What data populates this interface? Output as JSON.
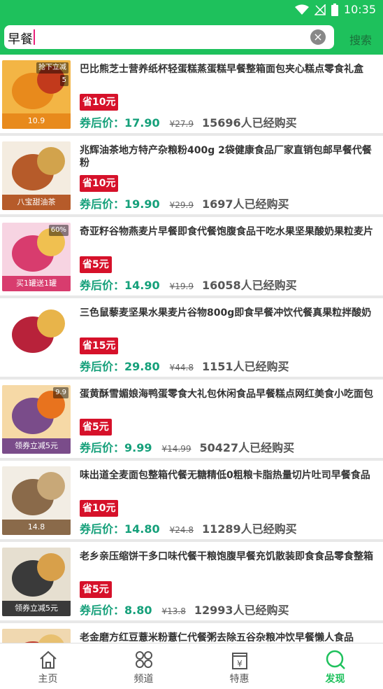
{
  "status_bar": {
    "time": "10:35"
  },
  "search": {
    "query": "早餐",
    "button_label": "搜索"
  },
  "products": [
    {
      "title": "巴比熊芝士营养纸杯轻蛋糕蒸蛋糕早餐整箱面包夹心糕点零食礼盒",
      "coupon": "省10元",
      "after_price": "券后价：17.90",
      "original_price": "¥27.9",
      "sold": "15696人已经购买",
      "thumb_colors": [
        "#f3b545",
        "#e88a1c",
        "#c23a1c"
      ],
      "thumb_texts": [
        "10.9",
        "抢下立减",
        "5"
      ]
    },
    {
      "title": "兆辉油茶地方特产杂粮粉400g 2袋健康食品厂家直销包邮早餐代餐粉",
      "coupon": "省10元",
      "after_price": "券后价：19.90",
      "original_price": "¥29.9",
      "sold": "1697人已经购买",
      "thumb_colors": [
        "#f4ece0",
        "#b65b2a",
        "#d2a34c"
      ],
      "thumb_texts": [
        "八宝甜油茶"
      ]
    },
    {
      "title": "奇亚籽谷物燕麦片早餐即食代餐饱腹食品干吃水果坚果酸奶果粒麦片",
      "coupon": "省5元",
      "after_price": "券后价：14.90",
      "original_price": "¥19.9",
      "sold": "16058人已经购买",
      "thumb_colors": [
        "#f7d4e2",
        "#d83c6e",
        "#f0c050"
      ],
      "thumb_texts": [
        "买1罐送1罐",
        "60%"
      ]
    },
    {
      "title": "三色鼠藜麦坚果水果麦片谷物800g即食早餐冲饮代餐真果粒拌酸奶",
      "coupon": "省15元",
      "after_price": "券后价：29.80",
      "original_price": "¥44.8",
      "sold": "1151人已经购买",
      "thumb_colors": [
        "#ffffff",
        "#b8223a",
        "#e8b44a"
      ],
      "thumb_texts": []
    },
    {
      "title": "蛋黄酥雪媚娘海鸭蛋零食大礼包休闲食品早餐糕点网红美食小吃面包",
      "coupon": "省5元",
      "after_price": "券后价：9.99",
      "original_price": "¥14.99",
      "sold": "50427人已经购买",
      "thumb_colors": [
        "#f6d9a6",
        "#7a4c8a",
        "#e8731e"
      ],
      "thumb_texts": [
        "领券立减5元",
        "9.9"
      ]
    },
    {
      "title": "味出道全麦面包整箱代餐无糖精低0粗粮卡脂热量切片吐司早餐食品",
      "coupon": "省10元",
      "after_price": "券后价：14.80",
      "original_price": "¥24.8",
      "sold": "11289人已经购买",
      "thumb_colors": [
        "#f2ede4",
        "#8a6a4a",
        "#c8a878"
      ],
      "thumb_texts": [
        "14.8"
      ]
    },
    {
      "title": "老乡亲压缩饼干多口味代餐干粮饱腹早餐充饥散装即食食品零食整箱",
      "coupon": "省5元",
      "after_price": "券后价：8.80",
      "original_price": "¥13.8",
      "sold": "12993人已经购买",
      "thumb_colors": [
        "#e6dfd0",
        "#3a3a3a",
        "#d8a04a"
      ],
      "thumb_texts": [
        "领券立减5元"
      ]
    },
    {
      "title": "老金磨方红豆薏米粉薏仁代餐粥去除五谷杂粮冲饮早餐懒人食品",
      "coupon": "",
      "after_price": "",
      "original_price": "",
      "sold": "",
      "thumb_colors": [
        "#f0d8b0",
        "#c0392b",
        "#e8c070"
      ],
      "thumb_texts": []
    }
  ],
  "bottom_nav": [
    {
      "label": "主页",
      "icon": "home-icon",
      "active": false
    },
    {
      "label": "频道",
      "icon": "channels-icon",
      "active": false
    },
    {
      "label": "特惠",
      "icon": "deals-icon",
      "active": false
    },
    {
      "label": "发现",
      "icon": "discover-icon",
      "active": true
    }
  ],
  "colors": {
    "brand_green": "#1ec15c",
    "coupon_red": "#d6112a",
    "price_teal": "#15a07a"
  }
}
